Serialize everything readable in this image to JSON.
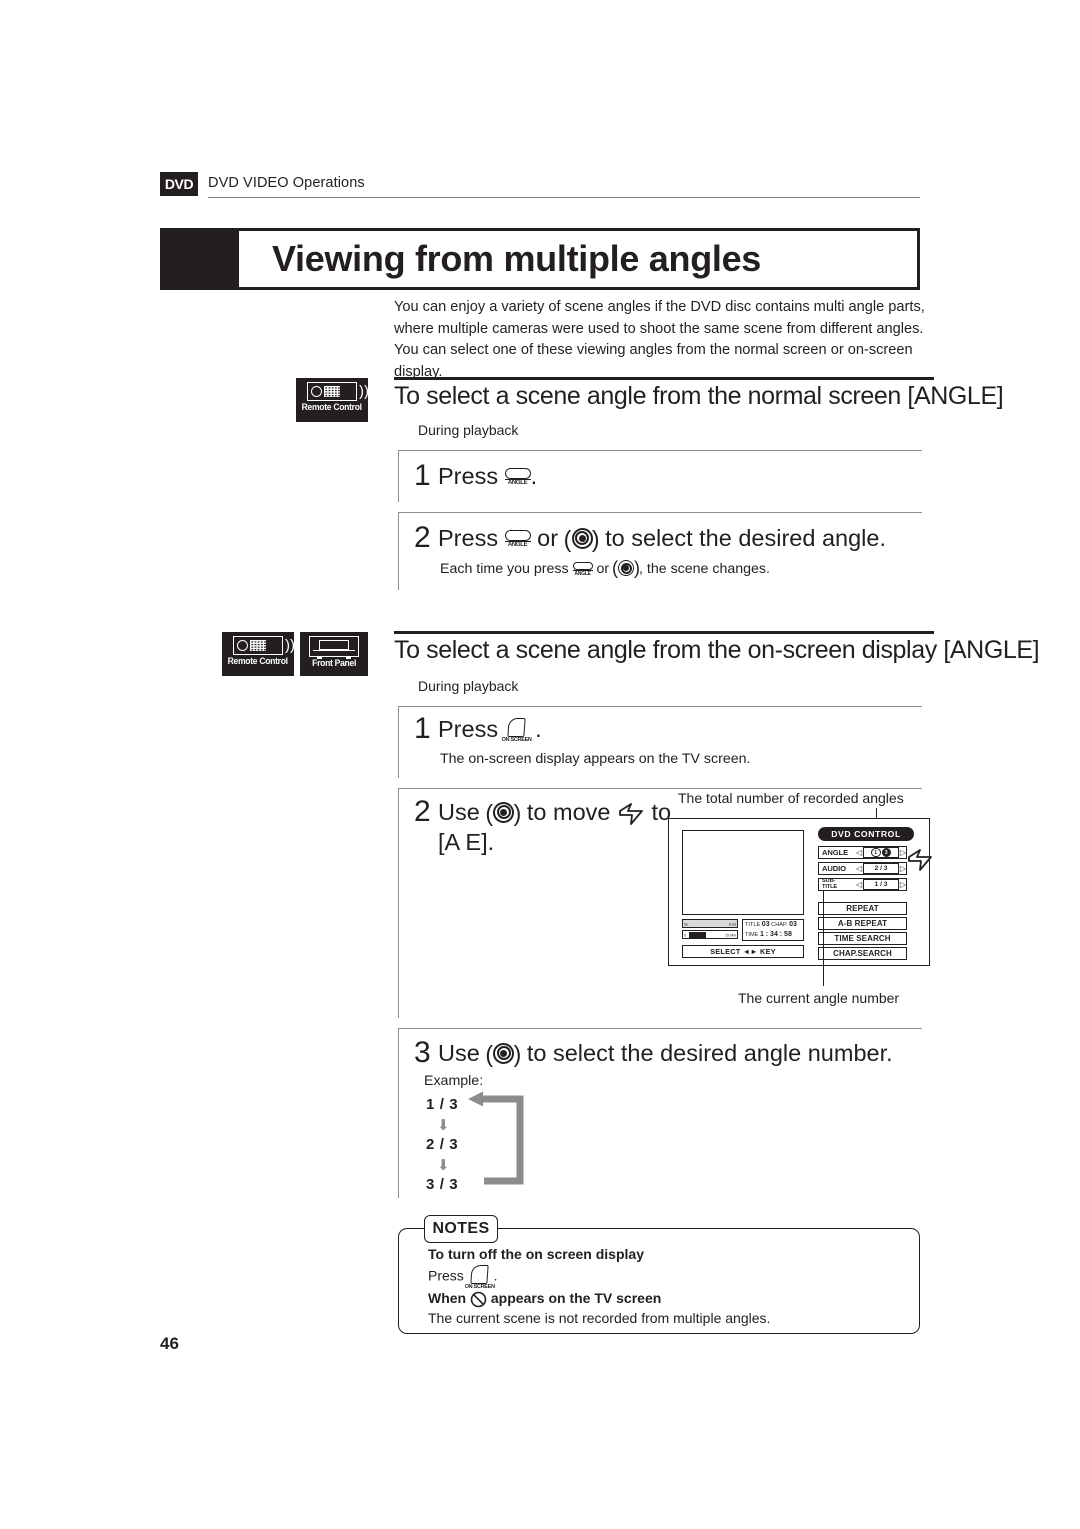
{
  "runhead": {
    "badge": "DVD",
    "text": "DVD VIDEO Operations"
  },
  "title": "Viewing from multiple angles",
  "intro": "You can enjoy a variety of scene angles if the DVD disc contains   multi angle parts, where multiple cameras were used to shoot the same scene from different angles.  You can select one of these viewing angles from the normal screen or on-screen display.",
  "section1": {
    "device_tags": [
      {
        "name": "Remote Control"
      }
    ],
    "heading": "To select a scene angle from the normal screen [ANGLE]",
    "condition": "During playback",
    "steps": [
      {
        "num": "1",
        "text_before": "Press",
        "text_after": ".",
        "icons": [
          "angle-button"
        ],
        "note": ""
      },
      {
        "num": "2",
        "text_before": "Press",
        "text_mid": "or",
        "text_after": "to select the desired angle.",
        "icons": [
          "angle-button",
          "cursor-wheel"
        ],
        "note_a": "Each time you press",
        "note_b": "or",
        "note_c": ", the scene changes."
      }
    ]
  },
  "section2": {
    "device_tags": [
      {
        "name": "Remote Control"
      },
      {
        "name": "Front Panel"
      }
    ],
    "heading": "To select a scene angle from the on-screen display [ANGLE]",
    "condition": "During playback",
    "steps": [
      {
        "num": "1",
        "text_before": "Press",
        "text_after": ".",
        "note": "The on-screen display appears on the TV screen."
      },
      {
        "num": "2",
        "text_before": "Use",
        "text_mid": "to move",
        "text_after": "to",
        "text_line2": "[A        E]."
      },
      {
        "num": "3",
        "text_before": "Use",
        "text_after": "to select the desired angle number.",
        "example_label": "Example:",
        "example_sequence": [
          "1 / 3",
          "2 / 3",
          "3 / 3"
        ]
      }
    ]
  },
  "osd": {
    "callout_top": "The total number of recorded angles",
    "callout_bottom": "The current angle number",
    "panel_title": "DVD CONTROL",
    "rows": [
      {
        "label": "ANGLE",
        "current": "1",
        "total": "3",
        "highlight": true
      },
      {
        "label": "AUDIO",
        "value": "2 / 3"
      },
      {
        "label_line1": "SUB-",
        "label_line2": "TITLE",
        "value": "1 / 3"
      }
    ],
    "buttons": [
      "REPEAT",
      "A-B REPEAT",
      "TIME SEARCH",
      "CHAP.SEARCH"
    ],
    "info": {
      "bar_top_left": "SL",
      "bar_top_right": "End",
      "bar_bottom_left": "0",
      "bar_bottom_right": "15 Min",
      "title_label": "TITLE",
      "title_value": "03",
      "chap_label": "CHAP.",
      "chap_value": "03",
      "time_label": "TIME",
      "time_value": "1 : 34 : 58",
      "select_key": "SELECT ◄► KEY"
    }
  },
  "notes": {
    "tab": "NOTES",
    "heading1": "To turn off the on screen display",
    "line1_before": "Press",
    "line1_after": ".",
    "heading2_before": "When",
    "heading2_after": "appears on the TV screen",
    "line2": "The current scene is not recorded from multiple angles."
  },
  "page_number": "46",
  "icon_names": {
    "angle_button": "angle-button-icon",
    "onscreen_button": "on-screen-button-icon",
    "cursor_wheel": "cursor-wheel-icon",
    "pointer": "pointer-cursor-icon",
    "no_angle": "no-angle-prohibition-icon"
  },
  "colors": {
    "ink": "#231f20",
    "rule": "#8c8c8c",
    "loop_arrow": "#8c8c8c"
  }
}
